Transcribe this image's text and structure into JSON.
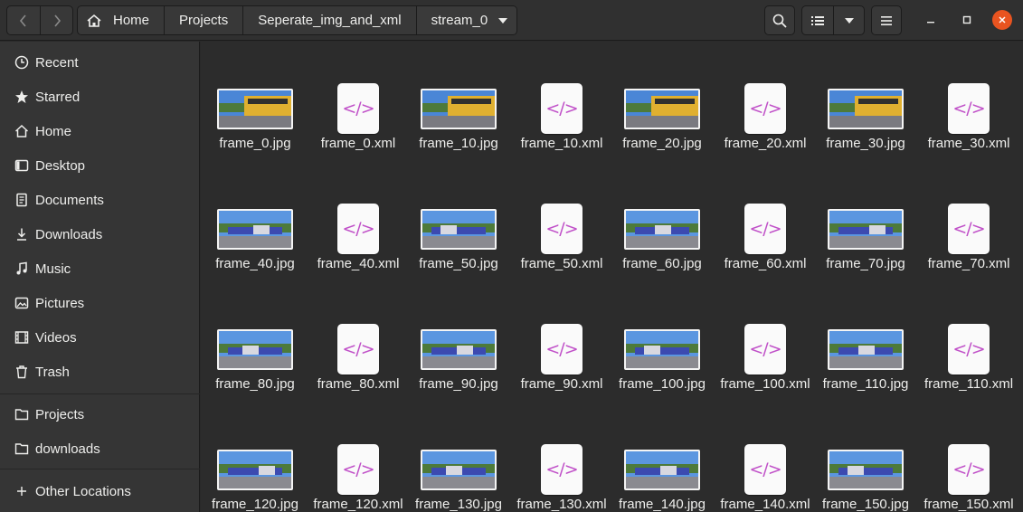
{
  "header": {
    "back_icon": "chevron-left-icon",
    "forward_icon": "chevron-right-icon",
    "breadcrumbs": [
      "Home",
      "Projects",
      "Seperate_img_and_xml",
      "stream_0"
    ]
  },
  "sidebar": {
    "items": [
      {
        "label": "Recent",
        "icon": "clock-icon"
      },
      {
        "label": "Starred",
        "icon": "star-icon"
      },
      {
        "label": "Home",
        "icon": "home-icon"
      },
      {
        "label": "Desktop",
        "icon": "desktop-icon"
      },
      {
        "label": "Documents",
        "icon": "documents-icon"
      },
      {
        "label": "Downloads",
        "icon": "download-icon"
      },
      {
        "label": "Music",
        "icon": "music-icon"
      },
      {
        "label": "Pictures",
        "icon": "pictures-icon"
      },
      {
        "label": "Videos",
        "icon": "videos-icon"
      },
      {
        "label": "Trash",
        "icon": "trash-icon"
      }
    ],
    "bookmarks": [
      {
        "label": "Projects",
        "icon": "folder-icon"
      },
      {
        "label": "downloads",
        "icon": "folder-icon"
      }
    ],
    "other": {
      "label": "Other Locations",
      "icon": "plus-icon"
    }
  },
  "files": [
    {
      "name": "frame_0.jpg",
      "type": "jpg"
    },
    {
      "name": "frame_0.xml",
      "type": "xml"
    },
    {
      "name": "frame_10.jpg",
      "type": "jpg"
    },
    {
      "name": "frame_10.xml",
      "type": "xml"
    },
    {
      "name": "frame_20.jpg",
      "type": "jpg"
    },
    {
      "name": "frame_20.xml",
      "type": "xml"
    },
    {
      "name": "frame_30.jpg",
      "type": "jpg"
    },
    {
      "name": "frame_30.xml",
      "type": "xml"
    },
    {
      "name": "frame_40.jpg",
      "type": "jpg"
    },
    {
      "name": "frame_40.xml",
      "type": "xml"
    },
    {
      "name": "frame_50.jpg",
      "type": "jpg"
    },
    {
      "name": "frame_50.xml",
      "type": "xml"
    },
    {
      "name": "frame_60.jpg",
      "type": "jpg"
    },
    {
      "name": "frame_60.xml",
      "type": "xml"
    },
    {
      "name": "frame_70.jpg",
      "type": "jpg"
    },
    {
      "name": "frame_70.xml",
      "type": "xml"
    },
    {
      "name": "frame_80.jpg",
      "type": "jpg"
    },
    {
      "name": "frame_80.xml",
      "type": "xml"
    },
    {
      "name": "frame_90.jpg",
      "type": "jpg"
    },
    {
      "name": "frame_90.xml",
      "type": "xml"
    },
    {
      "name": "frame_100.jpg",
      "type": "jpg"
    },
    {
      "name": "frame_100.xml",
      "type": "xml"
    },
    {
      "name": "frame_110.jpg",
      "type": "jpg"
    },
    {
      "name": "frame_110.xml",
      "type": "xml"
    },
    {
      "name": "frame_120.jpg",
      "type": "jpg"
    },
    {
      "name": "frame_120.xml",
      "type": "xml"
    },
    {
      "name": "frame_130.jpg",
      "type": "jpg"
    },
    {
      "name": "frame_130.xml",
      "type": "xml"
    },
    {
      "name": "frame_140.jpg",
      "type": "jpg"
    },
    {
      "name": "frame_140.xml",
      "type": "xml"
    },
    {
      "name": "frame_150.jpg",
      "type": "jpg"
    },
    {
      "name": "frame_150.xml",
      "type": "xml"
    }
  ],
  "xml_glyph": "</>",
  "colors": {
    "accent_close": "#e95420",
    "xml_glyph": "#c050c8"
  }
}
